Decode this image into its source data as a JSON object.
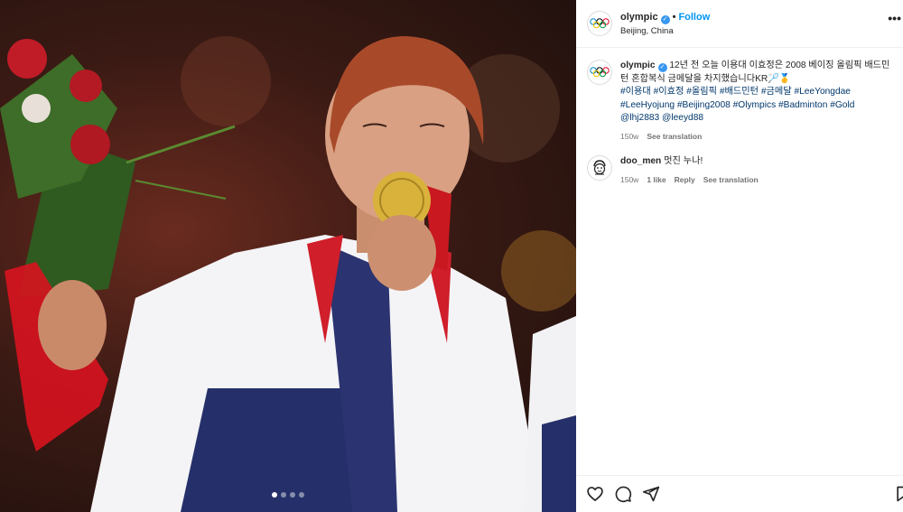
{
  "post": {
    "photo": {
      "description_icon": "medal-photo",
      "carousel_dots": 4,
      "carousel_active": 1
    },
    "header": {
      "username": "olympic",
      "verified": true,
      "separator": "•",
      "follow_label": "Follow",
      "location": "Beijing, China",
      "more_icon": "more-icon"
    },
    "caption": {
      "username": "olympic",
      "text": "12년 전 오늘 이용대 이효정은 2008 베이징 올림픽 배드민턴 혼합복식 금메달을 차지했습니다",
      "emoji": "KR🏸🥇",
      "hashtags": "#이용대 #이효정 #올림픽 #배드민턴 #금메달 #LeeYongdae #LeeHyojung #Beijing2008 #Olympics #Badminton #Gold @lhj2883 @leeyd88",
      "time": "150w",
      "see_translation": "See translation"
    },
    "comments": [
      {
        "username": "doo_men",
        "text": "멋진 누나!",
        "time": "150w",
        "likes": "1 like",
        "reply": "Reply",
        "see_translation": "See translation"
      }
    ],
    "actions": {
      "like_icon": "heart-icon",
      "comment_icon": "comment-icon",
      "share_icon": "share-icon",
      "save_icon": "bookmark-icon"
    },
    "colors": {
      "link": "#0095f6",
      "hashtag": "#00376b",
      "muted": "#737373",
      "verified": "#3897f0"
    }
  }
}
